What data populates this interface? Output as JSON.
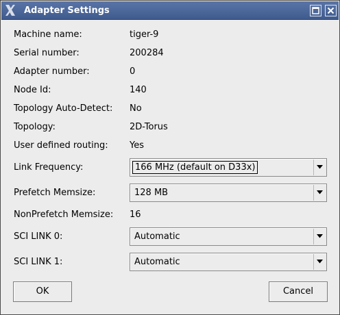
{
  "window": {
    "title": "Adapter Settings",
    "logo_icon": "x-logo-icon",
    "maximize_icon": "maximize-icon",
    "close_icon": "close-icon"
  },
  "fields": {
    "machine_name": {
      "label": "Machine name:",
      "value": "tiger-9"
    },
    "serial_number": {
      "label": "Serial number:",
      "value": "200284"
    },
    "adapter_number": {
      "label": "Adapter number:",
      "value": "0"
    },
    "node_id": {
      "label": "Node Id:",
      "value": "140"
    },
    "topology_autodetect": {
      "label": "Topology Auto-Detect:",
      "value": "No"
    },
    "topology": {
      "label": "Topology:",
      "value": "2D-Torus"
    },
    "user_routing": {
      "label": "User defined routing:",
      "value": "Yes"
    },
    "link_frequency": {
      "label": "Link Frequency:",
      "selected": "166 MHz (default on D33x)"
    },
    "prefetch_memsize": {
      "label": "Prefetch Memsize:",
      "selected": "128 MB"
    },
    "nonprefetch_memsize": {
      "label": "NonPrefetch Memsize:",
      "value": "16"
    },
    "sci_link_0": {
      "label": "SCI LINK 0:",
      "selected": "Automatic"
    },
    "sci_link_1": {
      "label": "SCI LINK 1:",
      "selected": "Automatic"
    }
  },
  "buttons": {
    "ok": "OK",
    "cancel": "Cancel"
  },
  "colors": {
    "titlebar": "#4a6699",
    "window_bg": "#ececec"
  }
}
